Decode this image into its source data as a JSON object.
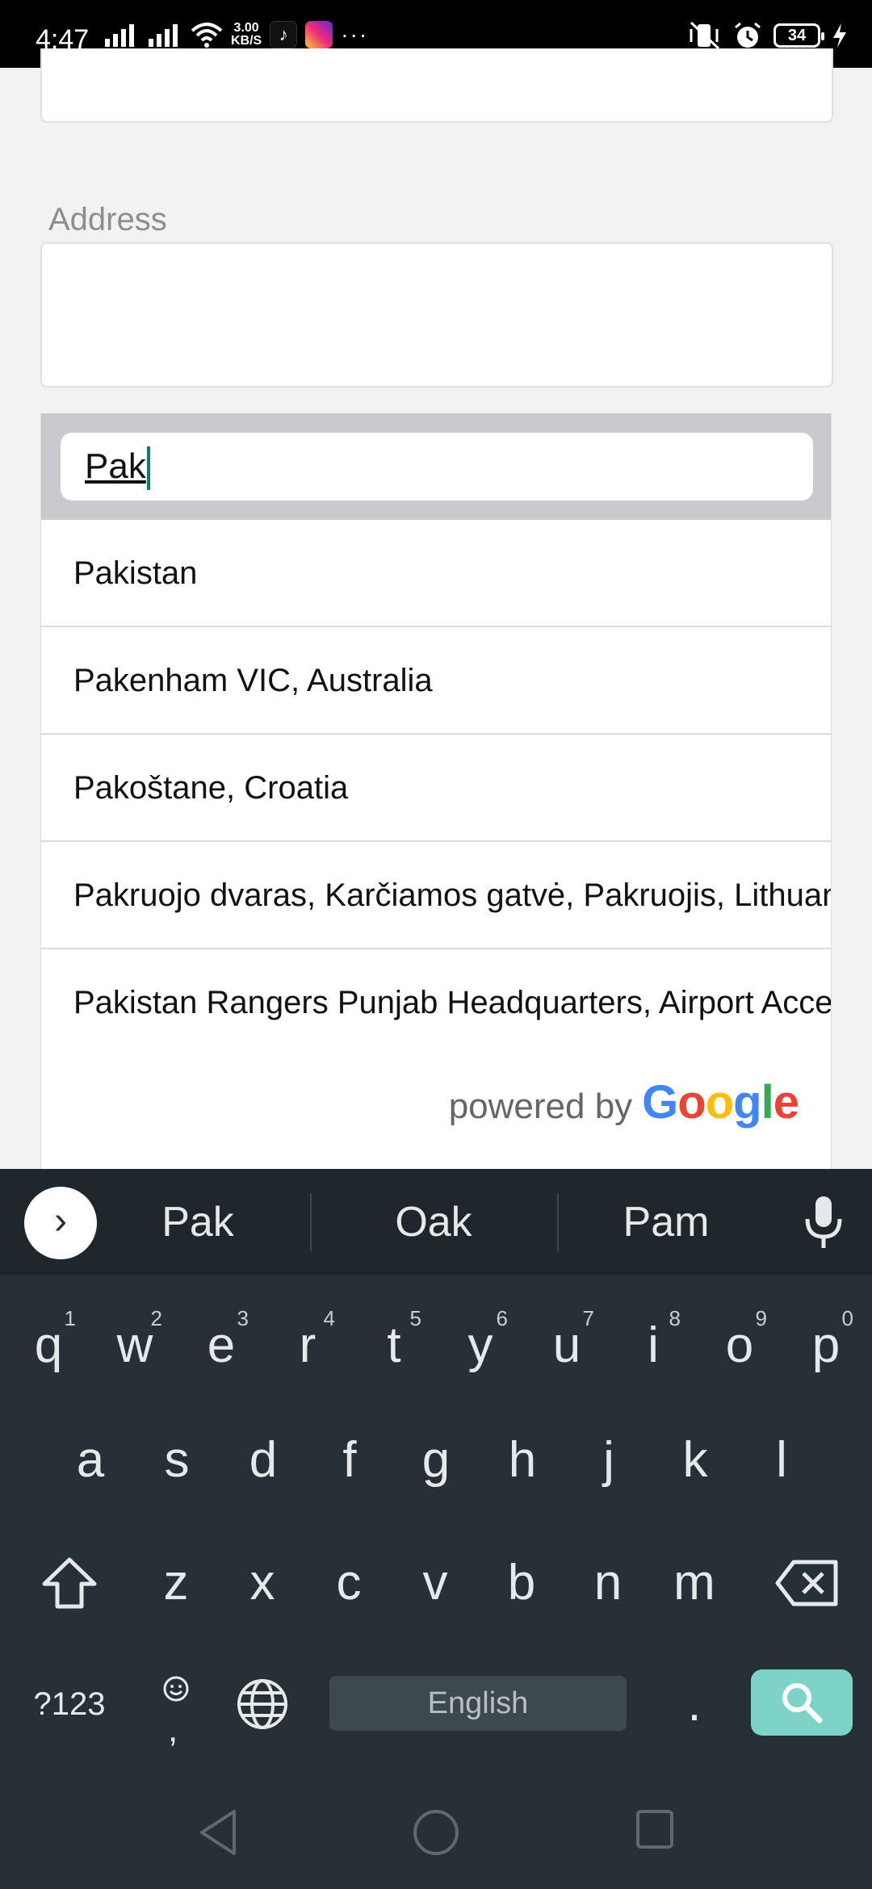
{
  "status_bar": {
    "time": "4:47",
    "speed_value": "3.00",
    "speed_unit": "KB/S",
    "more": "···",
    "battery": "34",
    "icons": [
      "signal-icon",
      "signal-icon",
      "wifi-icon",
      "tiktok-icon",
      "instagram-icon",
      "vibrate-off-icon",
      "alarm-icon",
      "battery-icon",
      "charging-icon"
    ]
  },
  "form": {
    "address_label": "Address"
  },
  "autocomplete": {
    "query": "Pak",
    "results": [
      "Pakistan",
      "Pakenham VIC, Australia",
      "Pakoštane, Croatia",
      "Pakruojo dvaras, Karčiamos gatvė, Pakruojis, Lithuania",
      "Pakistan Rangers Punjab Headquarters, Airport Access Road"
    ],
    "powered_by": "powered by",
    "brand": "Google",
    "brand_colors": [
      "#4285F4",
      "#EA4335",
      "#FBBC05",
      "#4285F4",
      "#34A853",
      "#EA4335"
    ]
  },
  "keyboard": {
    "suggestions": [
      "Pak",
      "Oak",
      "Pam"
    ],
    "row1": [
      {
        "key": "q",
        "num": "1"
      },
      {
        "key": "w",
        "num": "2"
      },
      {
        "key": "e",
        "num": "3"
      },
      {
        "key": "r",
        "num": "4"
      },
      {
        "key": "t",
        "num": "5"
      },
      {
        "key": "y",
        "num": "6"
      },
      {
        "key": "u",
        "num": "7"
      },
      {
        "key": "i",
        "num": "8"
      },
      {
        "key": "o",
        "num": "9"
      },
      {
        "key": "p",
        "num": "0"
      }
    ],
    "row2": [
      "a",
      "s",
      "d",
      "f",
      "g",
      "h",
      "j",
      "k",
      "l"
    ],
    "row3": [
      "z",
      "x",
      "c",
      "v",
      "b",
      "n",
      "m"
    ],
    "symbols_key": "?123",
    "comma": ",",
    "period": ".",
    "space_label": "English",
    "enter_color": "#7dd3c6",
    "background_color": "#263036"
  }
}
